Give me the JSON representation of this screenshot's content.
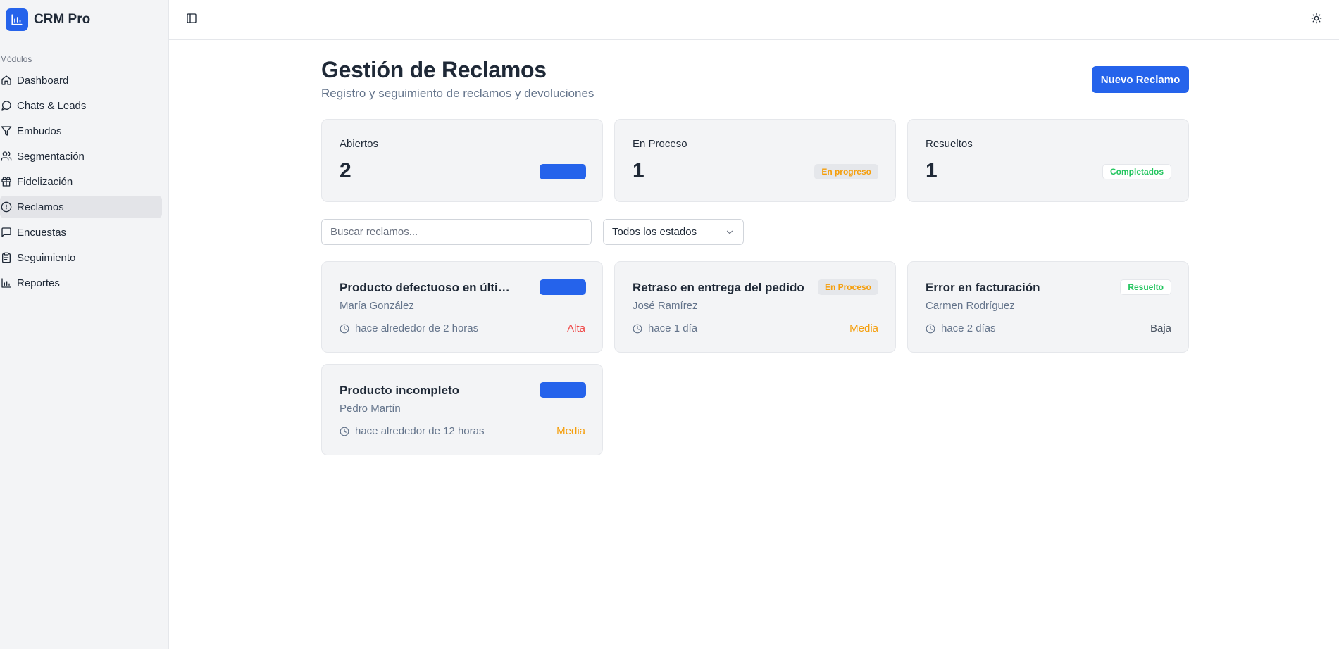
{
  "app": {
    "name": "CRM Pro"
  },
  "sidebar": {
    "section_label": "Módulos",
    "items": [
      {
        "label": "Dashboard",
        "icon": "home-icon"
      },
      {
        "label": "Chats & Leads",
        "icon": "chat-icon"
      },
      {
        "label": "Embudos",
        "icon": "filter-icon"
      },
      {
        "label": "Segmentación",
        "icon": "users-icon"
      },
      {
        "label": "Fidelización",
        "icon": "gift-icon"
      },
      {
        "label": "Reclamos",
        "icon": "alert-circle-icon",
        "active": true
      },
      {
        "label": "Encuestas",
        "icon": "message-square-icon"
      },
      {
        "label": "Seguimiento",
        "icon": "clipboard-icon"
      },
      {
        "label": "Reportes",
        "icon": "bar-chart-icon"
      }
    ]
  },
  "header": {
    "title": "Gestión de Reclamos",
    "subtitle": "Registro y seguimiento de reclamos y devoluciones",
    "new_button": "Nuevo Reclamo"
  },
  "stats": [
    {
      "title": "Abiertos",
      "value": "2",
      "badge": ""
    },
    {
      "title": "En Proceso",
      "value": "1",
      "badge": "En progreso"
    },
    {
      "title": "Resueltos",
      "value": "1",
      "badge": "Completados"
    }
  ],
  "filters": {
    "search_placeholder": "Buscar reclamos...",
    "status_selected": "Todos los estados"
  },
  "claims": [
    {
      "title": "Producto defectuoso en última compra",
      "person": "María González",
      "time": "hace alrededor de 2 horas",
      "priority": "Alta",
      "status": ""
    },
    {
      "title": "Retraso en entrega del pedido",
      "person": "José Ramírez",
      "time": "hace 1 día",
      "priority": "Media",
      "status": "En Proceso"
    },
    {
      "title": "Error en facturación",
      "person": "Carmen Rodríguez",
      "time": "hace 2 días",
      "priority": "Baja",
      "status": "Resuelto"
    },
    {
      "title": "Producto incompleto",
      "person": "Pedro Martín",
      "time": "hace alrededor de 12 horas",
      "priority": "Media",
      "status": ""
    }
  ],
  "colors": {
    "accent": "#2563eb",
    "priority_alta": "#ef4444",
    "priority_media": "#f59e0b",
    "priority_baja": "#4b5563",
    "status_progress": "#f59e0b",
    "status_done": "#22c55e"
  }
}
